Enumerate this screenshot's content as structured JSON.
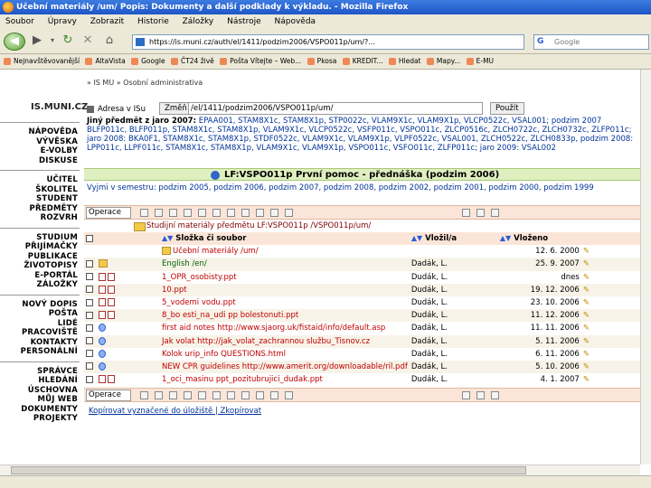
{
  "window": {
    "title": "Učební materiály /um/ Popis: Dokumenty a další podklady k výkladu. - Mozilla Firefox"
  },
  "menu": [
    "Soubor",
    "Úpravy",
    "Zobrazit",
    "Historie",
    "Záložky",
    "Nástroje",
    "Nápověda"
  ],
  "nav": {
    "url": "https://is.muni.cz/auth/el/1411/podzim2006/VSPO011p/um/?...",
    "search_placeholder": "Google"
  },
  "bookmarks": [
    "Nejnavštěvovanější",
    "AltaVista",
    "Google",
    "ČT24 živě",
    "Pošta Vítejte – Web...",
    "Pkosa",
    "KREDIT...",
    "Hledat",
    "Mapy...",
    "E-MU"
  ],
  "breadcrumb": "» IS MU » Osobní administrativa",
  "site": {
    "logo": "IS.MUNI.CZ",
    "nav_groups": [
      [
        "NÁPOVĚDA",
        "VÝVĚSKA",
        "E-VOLBY",
        "DISKUSE"
      ],
      [
        "UČITEL",
        "ŠKOLITEL",
        "STUDENT",
        "PŘEDMĚTY",
        "ROZVRH"
      ],
      [
        "STUDIUM",
        "PŘIJÍMAČKY",
        "PUBLIKACE",
        "ŽIVOTOPISY",
        "E-PORTÁL",
        "ZÁLOŽKY"
      ],
      [
        "NOVÝ DOPIS",
        "POŠTA",
        "LIDÉ",
        "PRACOVIŠTĚ",
        "KONTAKTY",
        "PERSONÁLNÍ"
      ],
      [
        "SPRÁVCE",
        "HLEDÁNÍ",
        "ÚSCHOVNA",
        "MŮJ WEB",
        "DOKUMENTY",
        "PROJEKTY"
      ]
    ]
  },
  "address": {
    "label": "Adresa v ISu",
    "change_button": "Změň",
    "value": "/el/1411/podzim2006/VSPO011p/um/",
    "use_button": "Použít"
  },
  "other_terms": {
    "lead": "Jiný předmět z jaro 2007:",
    "text": "EPAA001, STAM8X1c, STAM8X1p, STP0022c, VLAM9X1c, VLAM9X1p, VLCP0522c, VSAL001; podzim 2007 BLFP011c, BLFP011p, STAM8X1c, STAM8X1p, VLAM9X1c, VLCP0522c, VSFP011c, VSPO011c, ZLCP0516c, ZLCH0722c, ZLCH0732c, ZLFP011c; jaro 2008: BKA0F1, STAM8X1c, STAM8X1p, STDF0522c, VLAM9X1c, VLAM9X1p, VLPF0522c, VSAL001, ZLCH0522c, ZLCH0833p, podzim 2008: LPP011c, LLPF011c, STAM8X1c, STAM8X1p, VLAM9X1c, VLAM9X1p, VSPO011c, VSFO011c, ZLFP011c; jaro 2009: VSAL002"
  },
  "course_header": "LF:VSPO011p První pomoc - přednáška (podzim 2006)",
  "semesters": "Vyjmi v semestru: podzim 2005, podzim 2006, podzim 2007, podzim 2008, podzim 2002, podzim 2001, podzim 2000, podzim 1999",
  "toolbar": {
    "operations_label": "Operace"
  },
  "folder_path": "Studijní materiály předmětu LF:VSPO011p /VSPO011p/um/",
  "table": {
    "headers": {
      "name": "Složka či soubor",
      "owner": "Vložil/a",
      "date": "Vloženo"
    },
    "parent": {
      "name": "Učební materiály /um/",
      "date": "12. 6. 2000"
    },
    "rows": [
      {
        "name": "English /en/",
        "owner": "Dadák, L.",
        "date": "25. 9. 2007"
      },
      {
        "name": "1_OPR_osobisty.ppt",
        "owner": "Dudák, L.",
        "date": "dnes"
      },
      {
        "name": "10.ppt",
        "owner": "Dudák, L.",
        "date": "19. 12. 2006"
      },
      {
        "name": "5_vodemi vodu.ppt",
        "owner": "Dudák, L.",
        "date": "23. 10. 2006"
      },
      {
        "name": "8_bo esti_na_udi pp bolestonuti.ppt",
        "owner": "Dudák, L.",
        "date": "11. 12. 2006"
      },
      {
        "name": "first aid notes http://www.sjaorg.uk/fistaid/info/default.asp",
        "owner": "Dadák, L.",
        "date": "11. 11. 2006"
      },
      {
        "name": "Jak volat http://jak_volat_zachrannou službu_Tisnov.cz",
        "owner": "Dadák, L.",
        "date": "5. 11. 2006"
      },
      {
        "name": "Kolok urip_info QUESTIONS.html",
        "owner": "Dadák, L.",
        "date": "6. 11. 2006"
      },
      {
        "name": "NEW CPR guidelines http://www.amerit.org/downloadable/ril.pdf",
        "owner": "Dadák, L.",
        "date": "5. 10. 2006"
      },
      {
        "name": "1_oci_masinu ppt_pozitubrujici_dudak.ppt",
        "owner": "Dudák, L.",
        "date": "4. 1. 2007"
      }
    ]
  },
  "bottom_links": "Kopírovat vyznačené do úložiště | Zkopírovat"
}
